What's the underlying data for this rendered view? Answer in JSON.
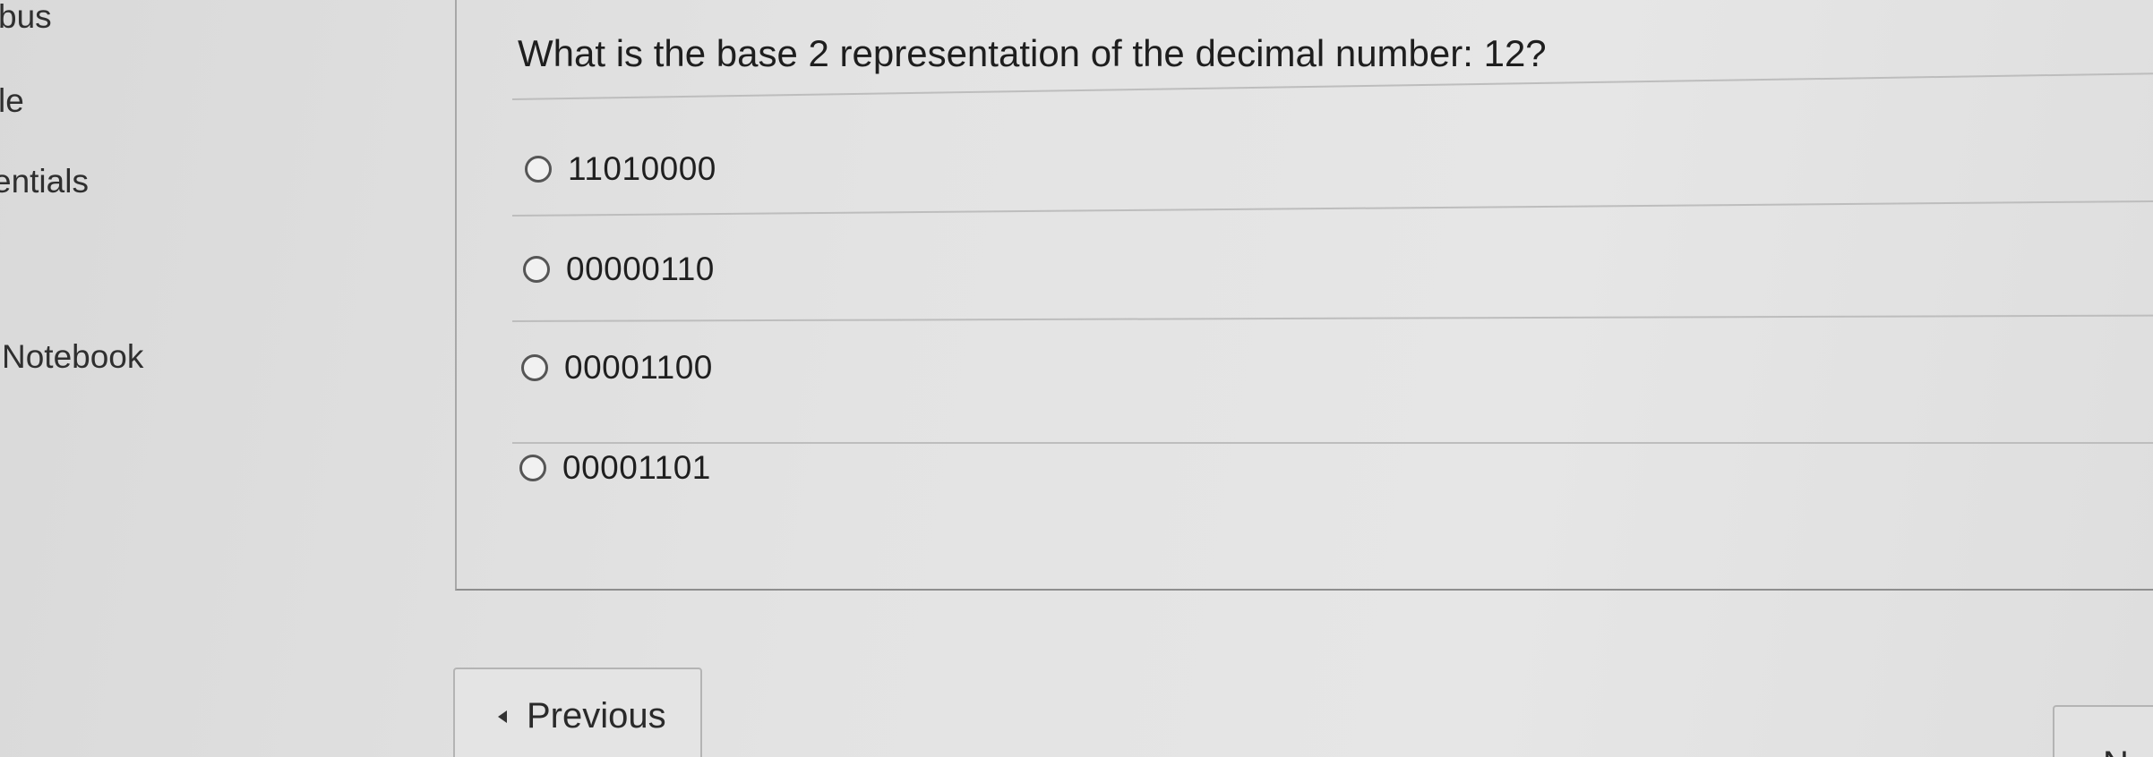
{
  "course_nav": {
    "items": [
      {
        "label": "bus"
      },
      {
        "label": "le"
      },
      {
        "label": "entials"
      },
      {
        "label": "Notebook"
      }
    ]
  },
  "question": {
    "text": "What is the base 2 representation of the decimal number: 12?",
    "answers": [
      {
        "label": "11010000",
        "selected": false
      },
      {
        "label": "00000110",
        "selected": false
      },
      {
        "label": "00001100",
        "selected": false
      },
      {
        "label": "00001101",
        "selected": false
      }
    ]
  },
  "navigation": {
    "previous_label": "Previous",
    "next_label": "N"
  }
}
